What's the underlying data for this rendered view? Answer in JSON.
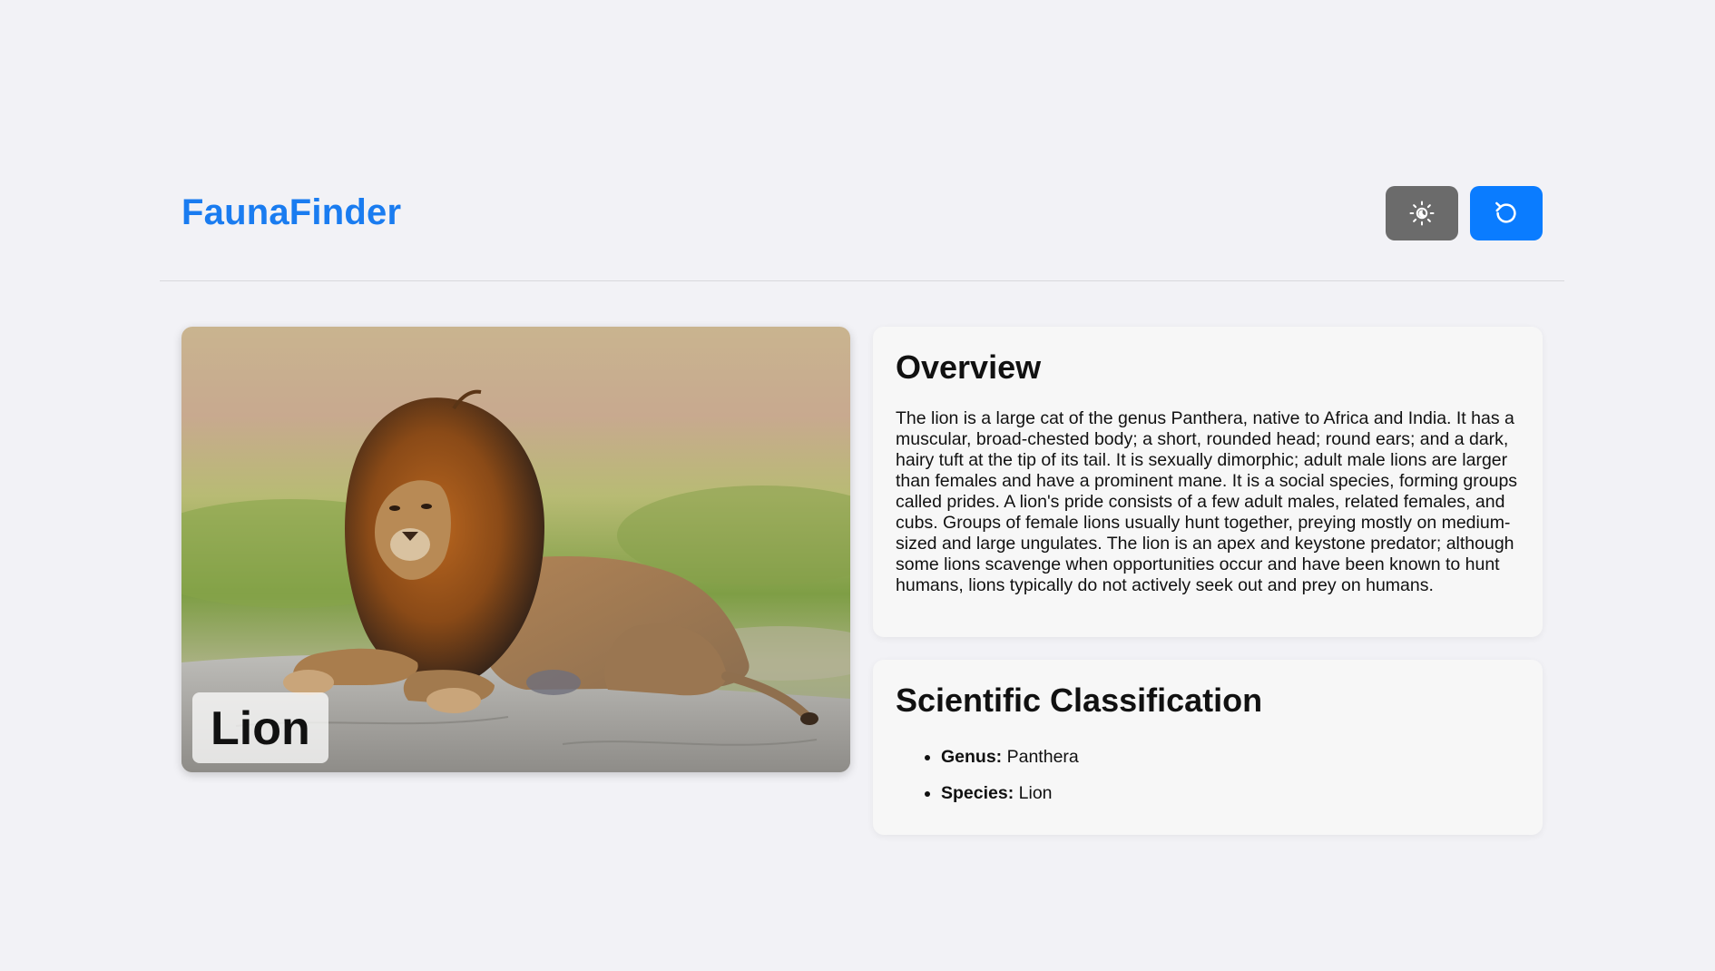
{
  "app": {
    "brand": "FaunaFinder"
  },
  "header": {
    "theme_toggle_icon": "sun-moon-icon",
    "reset_icon": "refresh-icon",
    "colors": {
      "brand": "#1a7cf0",
      "theme_button": "#6b6b6b",
      "reset_button": "#0a7cff"
    }
  },
  "animal": {
    "name": "Lion",
    "image_subject": "lion-photo"
  },
  "overview": {
    "title": "Overview",
    "text": "The lion is a large cat of the genus Panthera, native to Africa and India. It has a muscular, broad-chested body; a short, rounded head; round ears; and a dark, hairy tuft at the tip of its tail. It is sexually dimorphic; adult male lions are larger than females and have a prominent mane. It is a social species, forming groups called prides. A lion's pride consists of a few adult males, related females, and cubs. Groups of female lions usually hunt together, preying mostly on medium-sized and large ungulates. The lion is an apex and keystone predator; although some lions scavenge when opportunities occur and have been known to hunt humans, lions typically do not actively seek out and prey on humans."
  },
  "classification": {
    "title": "Scientific Classification",
    "items": [
      {
        "label": "Genus:",
        "value": "Panthera"
      },
      {
        "label": "Species:",
        "value": "Lion"
      }
    ]
  }
}
